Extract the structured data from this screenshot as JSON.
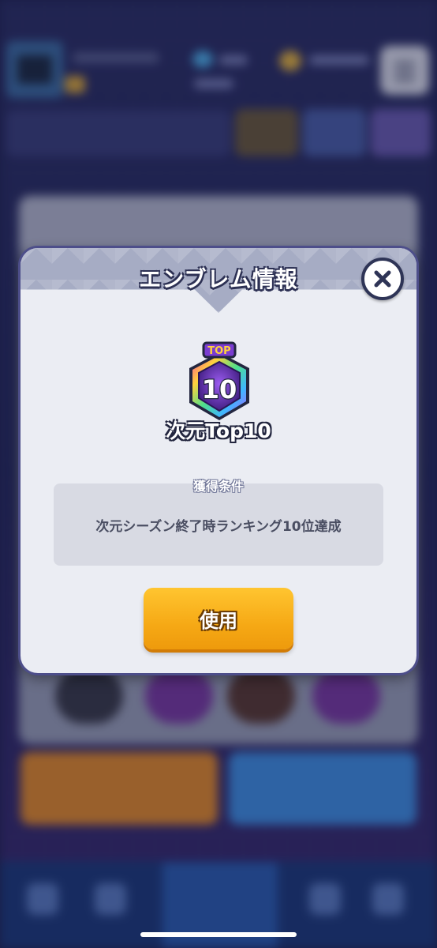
{
  "modal": {
    "title": "エンブレム情報",
    "emblem": {
      "badge_top_text": "TOP",
      "badge_number": "10",
      "name": "次元Top10"
    },
    "condition_label": "獲得条件",
    "condition_text": "次元シーズン終了時ランキング10位達成",
    "use_button_label": "使用",
    "close_icon": "close-icon"
  },
  "colors": {
    "modal_background": "#ebedf3",
    "header_band": "#a6acc4",
    "use_button": "#f6a915",
    "background_scrim": "#1f2350"
  }
}
